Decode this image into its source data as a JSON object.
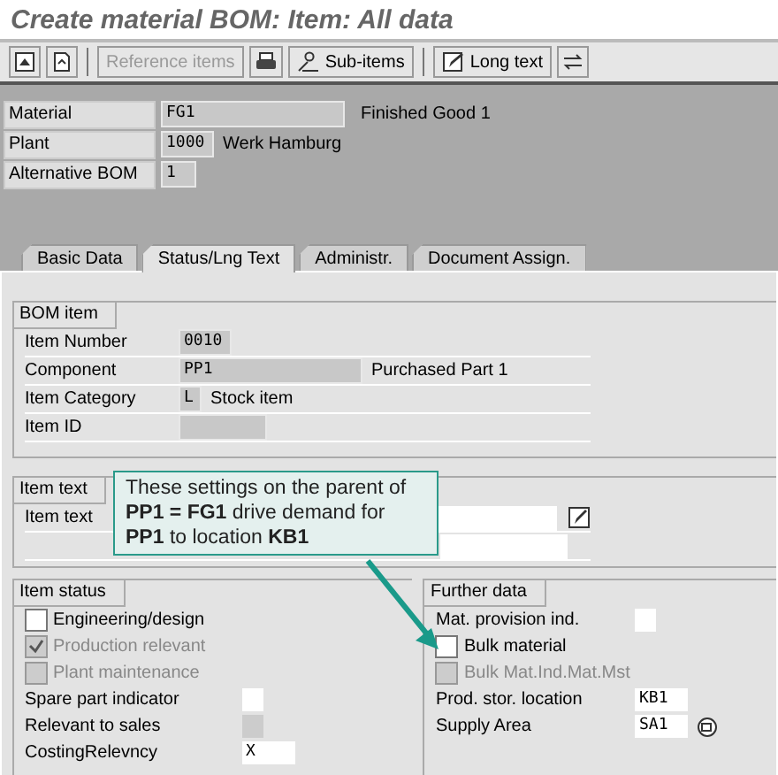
{
  "window": {
    "title": "Create material BOM: Item: All data"
  },
  "toolbar_buttons": [
    {
      "label": "Reference items",
      "disabled": true
    },
    {
      "label": "Sub-items",
      "disabled": false
    },
    {
      "label": "Long text",
      "disabled": false
    }
  ],
  "header": [
    {
      "label": "Material",
      "value": "FG1",
      "description": "Finished Good 1"
    },
    {
      "label": "Plant",
      "value": "1000",
      "description": "Werk Hamburg"
    },
    {
      "label": "Alternative BOM",
      "value": "1"
    }
  ],
  "tabs": [
    {
      "label": "Basic Data",
      "selected": false
    },
    {
      "label": "Status/Lng Text",
      "selected": true
    },
    {
      "label": "Administr.",
      "selected": false
    },
    {
      "label": "Document Assign.",
      "selected": false
    }
  ],
  "bom_item": {
    "title": "BOM item",
    "fields": [
      {
        "label": "Item Number",
        "value": "0010"
      },
      {
        "label": "Component",
        "value": "PP1",
        "description": "Purchased Part 1"
      },
      {
        "label": "Item Category",
        "value": "L",
        "description": "Stock item"
      },
      {
        "label": "Item ID"
      }
    ]
  },
  "item_text": {
    "title": "Item text",
    "label": "Item text"
  },
  "callout": {
    "text": "These settings on the parent of **PP1 = FG1** drive demand for **PP1** to location **KB1**"
  },
  "item_status": {
    "title": "Item status",
    "rows": [
      {
        "kind": "checkbox",
        "label": "Engineering/design",
        "checked": false,
        "disabled": false
      },
      {
        "kind": "checkbox",
        "label": "Production relevant",
        "checked": true,
        "disabled": true
      },
      {
        "kind": "checkbox",
        "label": "Plant maintenance",
        "checked": false,
        "disabled": true
      },
      {
        "kind": "field",
        "label": "Spare part indicator",
        "disabled": false
      },
      {
        "kind": "field",
        "label": "Relevant to sales",
        "disabled": true
      },
      {
        "kind": "field",
        "label": "CostingRelevncy",
        "value": "X",
        "disabled": false
      }
    ]
  },
  "further_data": {
    "title": "Further data",
    "rows": [
      {
        "kind": "field",
        "label": "Mat. provision ind.",
        "disabled": false
      },
      {
        "kind": "checkbox",
        "label": "Bulk material",
        "checked": false,
        "disabled": false
      },
      {
        "kind": "checkbox",
        "label": "Bulk Mat.Ind.Mat.Mst",
        "checked": false,
        "disabled": true
      },
      {
        "kind": "field",
        "label": "Prod. stor. location",
        "value": "KB1",
        "disabled": false
      },
      {
        "kind": "field",
        "label": "Supply Area",
        "value": "SA1",
        "disabled": false,
        "search_help": true
      }
    ]
  }
}
